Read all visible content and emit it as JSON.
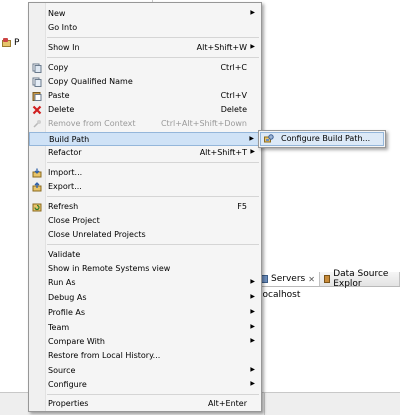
{
  "background": {
    "project_label": "P",
    "servers_tab": "Servers",
    "datasource_tab": "Data Source Explor",
    "server_item": "localhost"
  },
  "menu": {
    "new": {
      "label": "New"
    },
    "go_into": {
      "label": "Go Into"
    },
    "show_in": {
      "label": "Show In",
      "shortcut": "Alt+Shift+W"
    },
    "copy": {
      "label": "Copy",
      "shortcut": "Ctrl+C"
    },
    "copy_qualified": {
      "label": "Copy Qualified Name"
    },
    "paste": {
      "label": "Paste",
      "shortcut": "Ctrl+V"
    },
    "delete": {
      "label": "Delete",
      "shortcut": "Delete"
    },
    "remove_context": {
      "label": "Remove from Context",
      "shortcut": "Ctrl+Alt+Shift+Down"
    },
    "build_path": {
      "label": "Build Path"
    },
    "refactor": {
      "label": "Refactor",
      "shortcut": "Alt+Shift+T"
    },
    "import": {
      "label": "Import..."
    },
    "export": {
      "label": "Export..."
    },
    "refresh": {
      "label": "Refresh",
      "shortcut": "F5"
    },
    "close_project": {
      "label": "Close Project"
    },
    "close_unrelated": {
      "label": "Close Unrelated Projects"
    },
    "validate": {
      "label": "Validate"
    },
    "show_remote": {
      "label": "Show in Remote Systems view"
    },
    "run_as": {
      "label": "Run As"
    },
    "debug_as": {
      "label": "Debug As"
    },
    "profile_as": {
      "label": "Profile As"
    },
    "team": {
      "label": "Team"
    },
    "compare_with": {
      "label": "Compare With"
    },
    "restore_history": {
      "label": "Restore from Local History..."
    },
    "source": {
      "label": "Source"
    },
    "configure": {
      "label": "Configure"
    },
    "properties": {
      "label": "Properties",
      "shortcut": "Alt+Enter"
    }
  },
  "submenu": {
    "configure_build_path": {
      "label": "Configure Build Path..."
    }
  },
  "icons": {
    "arrow": "chevron-right-icon"
  }
}
